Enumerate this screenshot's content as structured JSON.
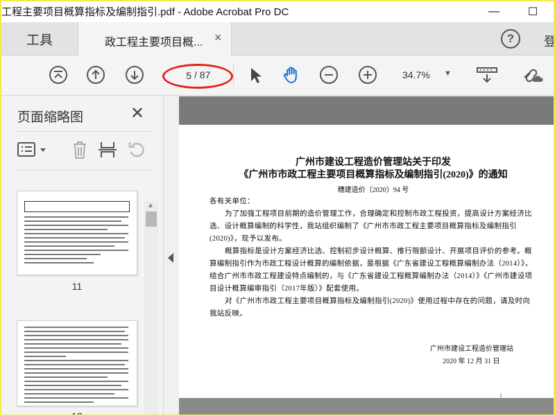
{
  "window": {
    "title": "工程主要项目概算指标及编制指引.pdf - Adobe Acrobat Pro DC",
    "minimize_icon": "—",
    "maximize_icon": "☐"
  },
  "tabs": {
    "tools": "工具",
    "document": "政工程主要项目概...",
    "close": "×",
    "help": "?",
    "signin": "登"
  },
  "toolbar": {
    "current_page": "5",
    "total_pages": "/ 87",
    "zoom": "34.7%",
    "zoom_caret": "▼"
  },
  "sidebar": {
    "title": "页面缩略图",
    "close": "✕",
    "thumbnails": [
      {
        "page": "11"
      },
      {
        "page": "12"
      }
    ],
    "scroll_up": "▲"
  },
  "document": {
    "heading_line1": "广州市建设工程造价管理站关于印发",
    "heading_line2": "《广州市市政工程主要项目概算指标及编制指引(2020)》的通知",
    "doc_number": "穗建造价〔2020〕94 号",
    "salutation": "各有关单位：",
    "para1": "为了加强工程项目前期的造价管理工作，合理确定和控制市政工程投资，提高设计方案经济比选、设计概算编制的科学性，我站组织编制了《广州市市政工程主要项目概算指标及编制指引(2020)》，现予以发布。",
    "para2": "概算指标是设计方案经济比选、控制初步设计概算、推行限额设计、开展项目评价的参考。概算编制指引作为市政工程设计概算的编制依据，是根据《广东省建设工程概算编制办法（2014）》，结合广州市市政工程建设特点编制的，与《广东省建设工程概算编制办法（2014）》《广州市建设项目设计概算编审指引（2017年版）》配套使用。",
    "para3": "对《广州市市政工程主要项目概算指标及编制指引(2020)》使用过程中存在的问题，请及时向我站反映。",
    "signature": "广州市建设工程造价管理站",
    "date": "2020 年 12 月 31 日",
    "page_mark": "1"
  }
}
